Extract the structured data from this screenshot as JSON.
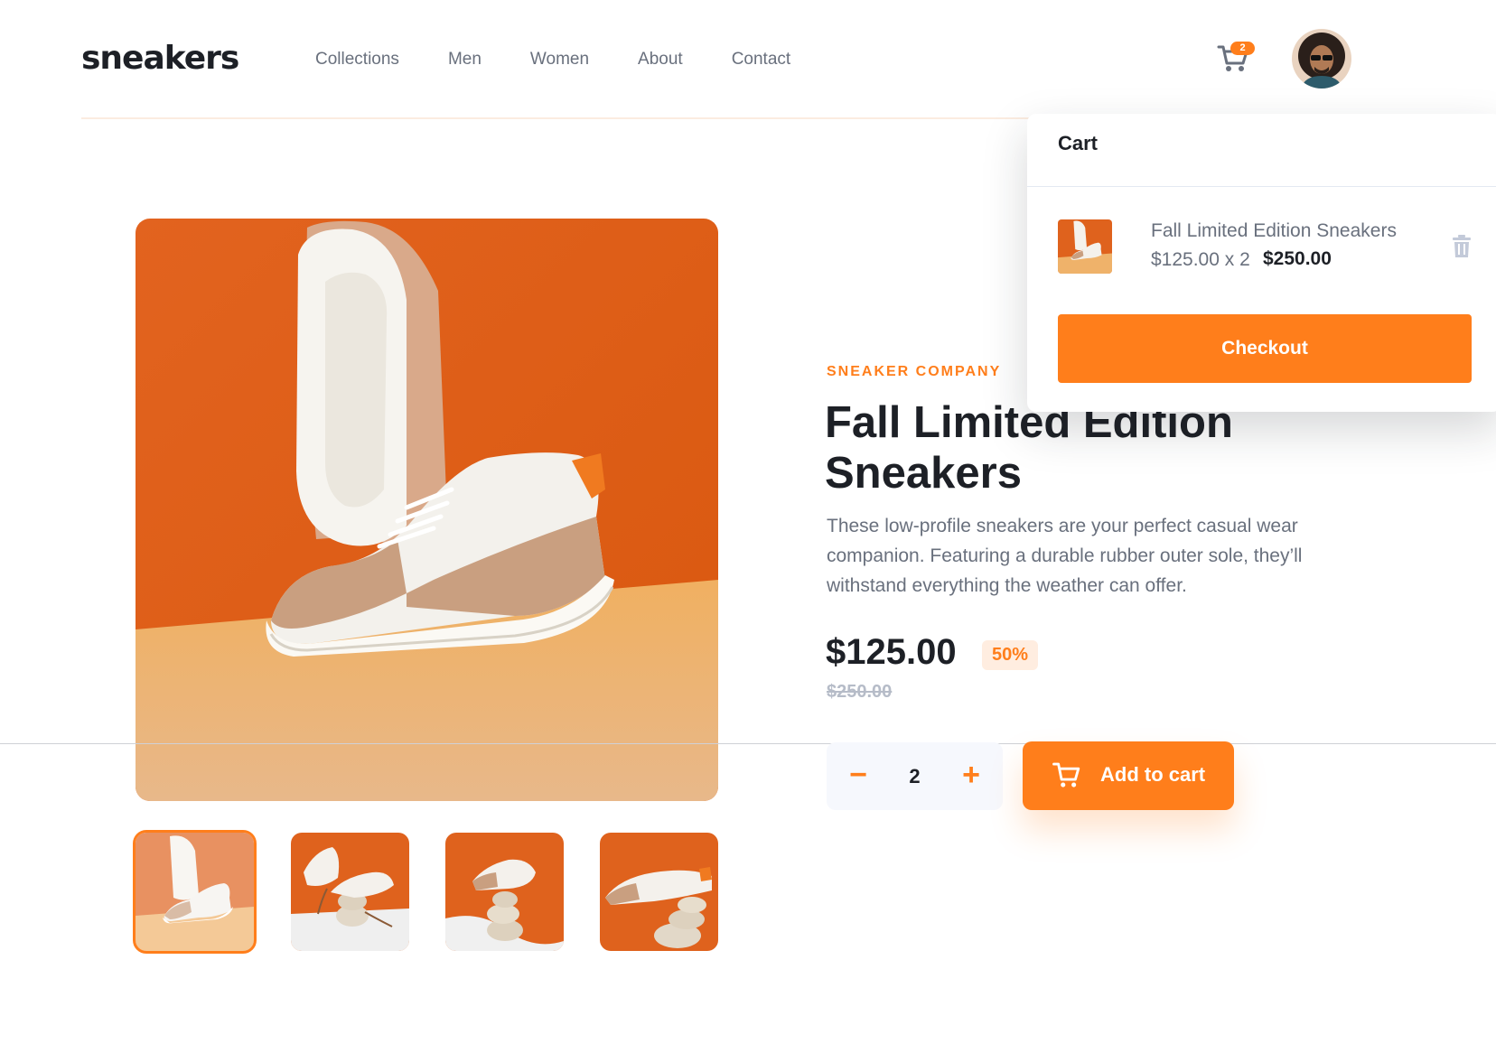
{
  "brand": {
    "logo": "sneakers"
  },
  "nav": {
    "items": [
      {
        "label": "Collections"
      },
      {
        "label": "Men"
      },
      {
        "label": "Women"
      },
      {
        "label": "About"
      },
      {
        "label": "Contact"
      }
    ]
  },
  "header": {
    "cart_count": "2",
    "cart_icon": "cart-icon",
    "avatar": "user-avatar"
  },
  "product": {
    "company": "SNEAKER COMPANY",
    "title": "Fall Limited Edition Sneakers",
    "description": "These low-profile sneakers are your perfect casual wear companion. Featuring a durable rubber outer sole, they’ll withstand everything the weather can offer.",
    "price": "$125.00",
    "discount": "50%",
    "original_price": "$250.00",
    "quantity": "2",
    "quantity_minus": "−",
    "quantity_plus": "+",
    "add_to_cart": "Add to cart",
    "thumbnails_count": 4,
    "active_thumbnail": 1
  },
  "cart": {
    "title": "Cart",
    "item": {
      "name": "Fall Limited Edition Sneakers",
      "calc": "$125.00 x 2",
      "total": "$250.00"
    },
    "checkout_label": "Checkout"
  },
  "colors": {
    "accent": "#ff7e1b",
    "accent_light": "#ffede0",
    "text_dark": "#1d2026",
    "text_gray": "#69707d",
    "text_light": "#b6bcc8",
    "bg_light": "#f6f8fd"
  }
}
